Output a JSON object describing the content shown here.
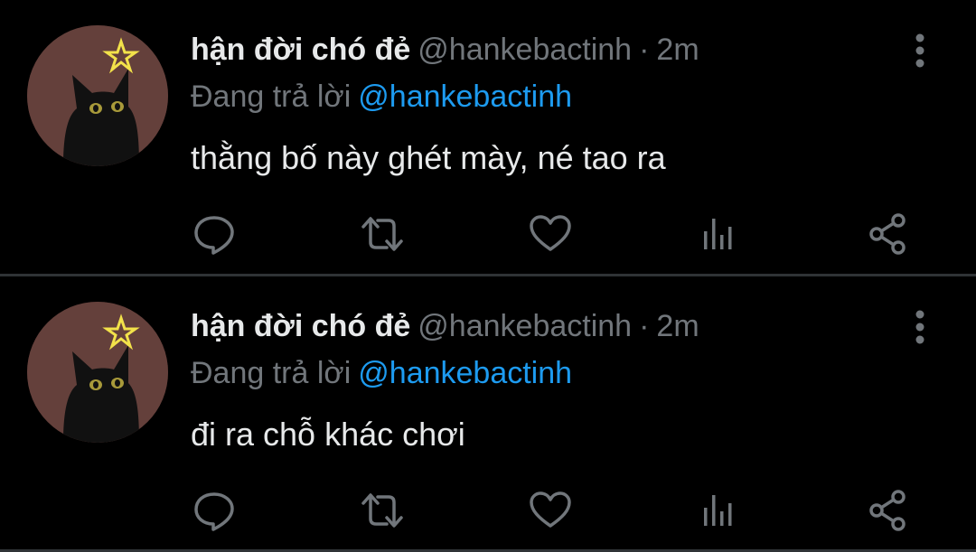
{
  "colors": {
    "background": "#000000",
    "divider": "#2f3336",
    "text": "#e7e9ea",
    "muted": "#71767b",
    "link": "#1d9bf0"
  },
  "tweets": [
    {
      "name": "hận đời chó đẻ",
      "handle": "@hankebactinh",
      "separator": "·",
      "time": "2m",
      "reply_prefix": "Đang trả lời",
      "reply_to": "@hankebactinh",
      "text": "thằng bố này ghét mày, né tao ra",
      "avatar_icon": "black-cat-avatar",
      "actions": [
        "reply-icon",
        "retweet-icon",
        "like-icon",
        "views-icon",
        "share-icon"
      ]
    },
    {
      "name": "hận đời chó đẻ",
      "handle": "@hankebactinh",
      "separator": "·",
      "time": "2m",
      "reply_prefix": "Đang trả lời",
      "reply_to": "@hankebactinh",
      "text": "đi ra chỗ khác chơi",
      "avatar_icon": "black-cat-avatar",
      "actions": [
        "reply-icon",
        "retweet-icon",
        "like-icon",
        "views-icon",
        "share-icon"
      ]
    }
  ]
}
